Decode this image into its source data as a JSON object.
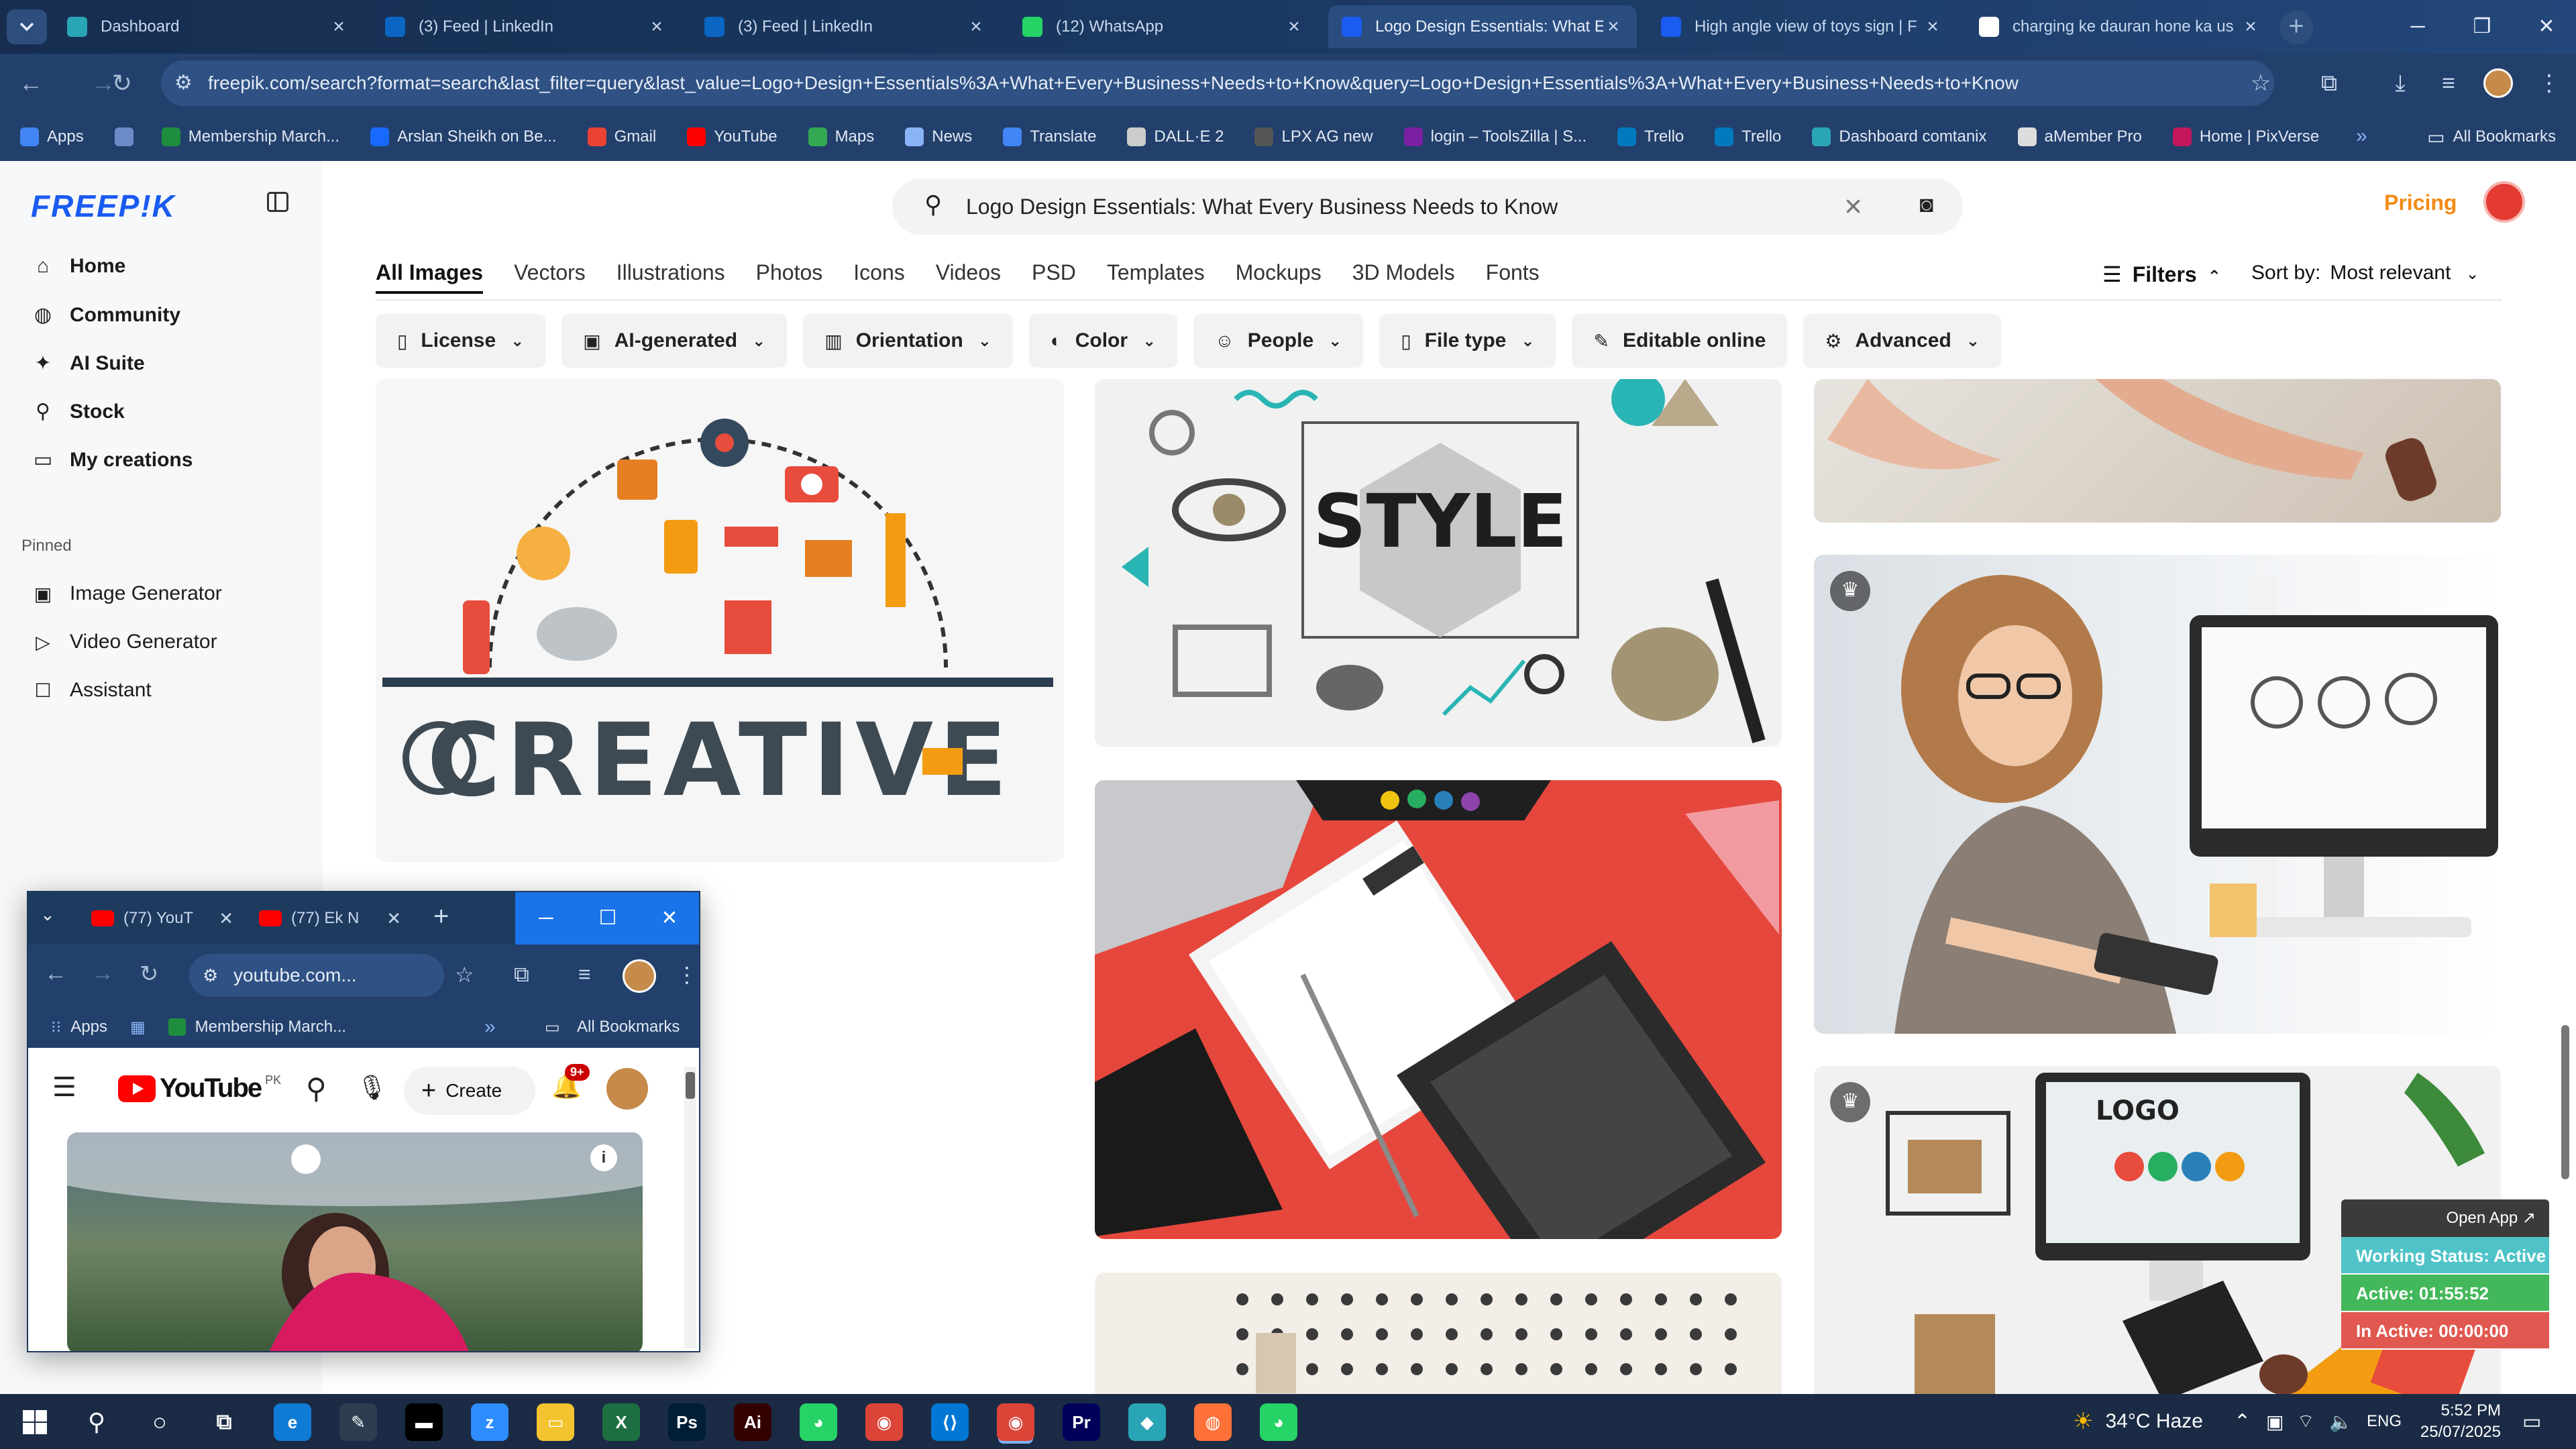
{
  "browser": {
    "tabs": [
      {
        "title": "Dashboard",
        "fav": "dashboard-icon",
        "color": "#2aa5b5"
      },
      {
        "title": "(3) Feed | LinkedIn",
        "fav": "linkedin-icon",
        "color": "#0a66c2"
      },
      {
        "title": "(3) Feed | LinkedIn",
        "fav": "linkedin-icon",
        "color": "#0a66c2"
      },
      {
        "title": "(12) WhatsApp",
        "fav": "whatsapp-icon",
        "color": "#25d366"
      },
      {
        "title": "Logo Design Essentials: What E",
        "fav": "freepik-icon",
        "color": "#1a5bf0"
      },
      {
        "title": "High angle view of toys sign | F",
        "fav": "freepik-icon",
        "color": "#1a5bf0"
      },
      {
        "title": "charging ke dauran hone ka us",
        "fav": "google-icon",
        "color": "#ffffff"
      }
    ],
    "url": "freepik.com/search?format=search&last_filter=query&last_value=Logo+Design+Essentials%3A+What+Every+Business+Needs+to+Know&query=Logo+Design+Essentials%3A+What+Every+Business+Needs+to+Know",
    "bookmarks": [
      {
        "label": "Apps",
        "color": "#4285f4"
      },
      {
        "label": "",
        "color": "#6b8cc7"
      },
      {
        "label": "Membership March...",
        "color": "#1e8e3e"
      },
      {
        "label": "Arslan Sheikh on Be...",
        "color": "#1769ff"
      },
      {
        "label": "Gmail",
        "color": "#ea4335"
      },
      {
        "label": "YouTube",
        "color": "#ff0000"
      },
      {
        "label": "Maps",
        "color": "#34a853"
      },
      {
        "label": "News",
        "color": "#8ab4f8"
      },
      {
        "label": "Translate",
        "color": "#4285f4"
      },
      {
        "label": "DALL·E 2",
        "color": "#cccccc"
      },
      {
        "label": "LPX AG new",
        "color": "#555555"
      },
      {
        "label": "login – ToolsZilla | S...",
        "color": "#7b1fa2"
      },
      {
        "label": "Trello",
        "color": "#0079bf"
      },
      {
        "label": "Trello",
        "color": "#0079bf"
      },
      {
        "label": "Dashboard comtanix",
        "color": "#2aa5b5"
      },
      {
        "label": "aMember Pro",
        "color": "#dddddd"
      },
      {
        "label": "Home | PixVerse",
        "color": "#c2185b"
      }
    ],
    "all_bookmarks": "All Bookmarks"
  },
  "freepik": {
    "logo": "FREEP!K",
    "nav": [
      {
        "label": "Home",
        "icon": "home-icon",
        "glyph": "⌂"
      },
      {
        "label": "Community",
        "icon": "globe-icon",
        "glyph": "◍"
      },
      {
        "label": "AI Suite",
        "icon": "sparkle-icon",
        "glyph": "✦"
      },
      {
        "label": "Stock",
        "icon": "search-icon",
        "glyph": "⚲"
      },
      {
        "label": "My creations",
        "icon": "folder-icon",
        "glyph": "▭"
      }
    ],
    "pinned_title": "Pinned",
    "pinned": [
      {
        "label": "Image Generator",
        "icon": "image-icon",
        "glyph": "▣"
      },
      {
        "label": "Video Generator",
        "icon": "video-icon",
        "glyph": "▷"
      },
      {
        "label": "Assistant",
        "icon": "chat-icon",
        "glyph": "☐"
      }
    ],
    "search_value": "Logo Design Essentials: What Every Business Needs to Know",
    "pricing": "Pricing",
    "categories": [
      "All Images",
      "Vectors",
      "Illustrations",
      "Photos",
      "Icons",
      "Videos",
      "PSD",
      "Templates",
      "Mockups",
      "3D Models",
      "Fonts"
    ],
    "filters_label": "Filters",
    "sort_label": "Sort by:",
    "sort_value": "Most relevant",
    "chips": [
      {
        "label": "License",
        "glyph": "▯"
      },
      {
        "label": "AI-generated",
        "glyph": "▣"
      },
      {
        "label": "Orientation",
        "glyph": "▥"
      },
      {
        "label": "Color",
        "glyph": "◐"
      },
      {
        "label": "People",
        "glyph": "☺"
      },
      {
        "label": "File type",
        "glyph": "▯"
      },
      {
        "label": "Editable online",
        "glyph": "✎"
      },
      {
        "label": "Advanced",
        "glyph": "⚙"
      }
    ],
    "card_texts": {
      "creative": "CREATIVE",
      "style": "STYLE",
      "logo": "LOGO"
    }
  },
  "status_widget": {
    "open_app": "Open App ↗",
    "working": "Working Status: Active",
    "active": "Active: 01:55:52",
    "inactive": "In Active: 00:00:00",
    "colors": {
      "working": "#4fc3c8",
      "active": "#43b85a",
      "inactive": "#e0584f"
    }
  },
  "mini_window": {
    "tabs": [
      "(77) YouT",
      "(77) Ek N"
    ],
    "url": "youtube.com...",
    "bookmarks": [
      "Apps",
      "Membership March...",
      "All Bookmarks"
    ],
    "youtube": {
      "create": "Create",
      "badge": "9+",
      "region": "PK"
    }
  },
  "taskbar": {
    "weather": "34°C  Haze",
    "lang": "ENG",
    "time": "5:52 PM",
    "date": "25/07/2025"
  }
}
